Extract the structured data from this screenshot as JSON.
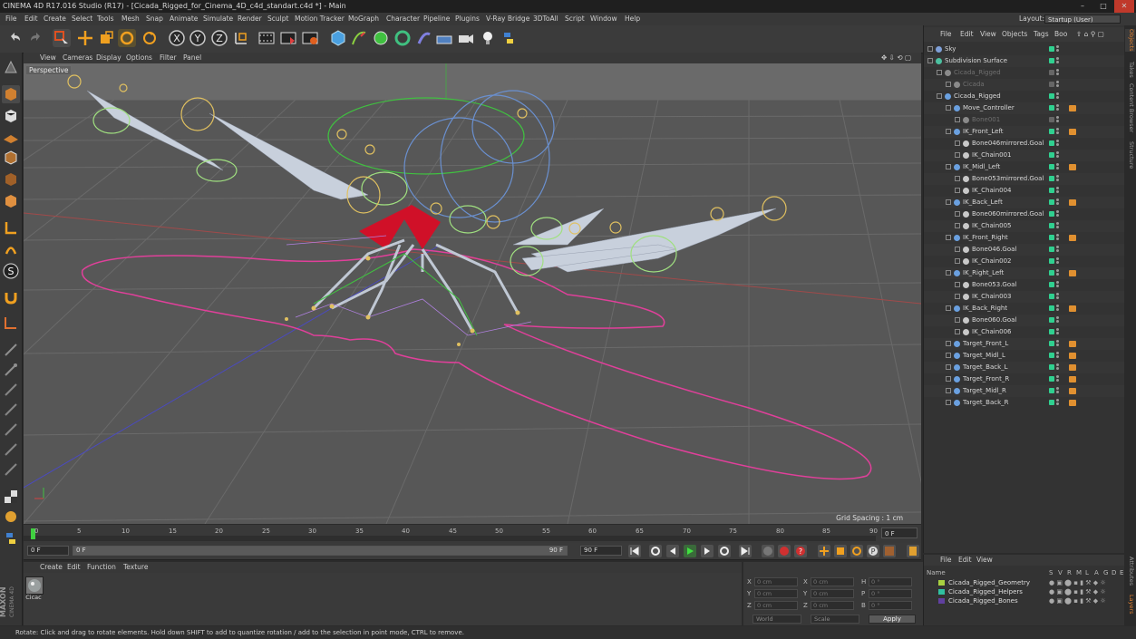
{
  "window": {
    "title": "CINEMA 4D R17.016 Studio (R17) - [Cicada_Rigged_for_Cinema_4D_c4d_standart.c4d *] - Main",
    "controls": [
      "–",
      "□",
      "✕"
    ]
  },
  "menubar": {
    "items": [
      "File",
      "Edit",
      "Create",
      "Select",
      "Tools",
      "Mesh",
      "Snap",
      "Animate",
      "Simulate",
      "Render",
      "Sculpt",
      "Motion Tracker",
      "MoGraph",
      "Character",
      "Pipeline",
      "Plugins",
      "V-Ray Bridge",
      "3DToAll",
      "Script",
      "Window",
      "Help"
    ],
    "layout_label": "Layout:",
    "layout_value": "Startup (User)"
  },
  "toolbar": {
    "axis_x": "X",
    "axis_y": "Y",
    "axis_z": "Z"
  },
  "viewport": {
    "menu": [
      "View",
      "Cameras",
      "Display",
      "Options",
      "Filter",
      "Panel"
    ],
    "label": "Perspective",
    "grid_spacing": "Grid Spacing : 1 cm"
  },
  "timeline": {
    "ticks": [
      "0",
      "5",
      "10",
      "15",
      "20",
      "25",
      "30",
      "35",
      "40",
      "45",
      "50",
      "55",
      "60",
      "65",
      "70",
      "75",
      "80",
      "85",
      "90"
    ],
    "current_frame": "0 F"
  },
  "transport": {
    "start_frame": "0 F",
    "range_start": "0 F",
    "range_end": "90 F",
    "end_frame": "90 F"
  },
  "material_panel": {
    "menu": [
      "Create",
      "Edit",
      "Function",
      "Texture"
    ],
    "material_name": "Cicac"
  },
  "coords": {
    "labels": [
      "X",
      "Y",
      "Z",
      "X",
      "Y",
      "Z",
      "H",
      "P",
      "B"
    ],
    "values": [
      "0 cm",
      "0 cm",
      "0 cm",
      "0 cm",
      "0 cm",
      "0 cm",
      "0 °",
      "0 °",
      "0 °"
    ],
    "mode": "World",
    "scale": "Scale",
    "apply": "Apply"
  },
  "object_manager": {
    "menu": [
      "File",
      "Edit",
      "View",
      "Objects",
      "Tags",
      "Boo"
    ],
    "rows": [
      {
        "name": "Sky",
        "indent": 0,
        "color": "#7fa0d8",
        "dim": false
      },
      {
        "name": "Subdivision Surface",
        "indent": 0,
        "color": "#4cc0a0",
        "dim": false
      },
      {
        "name": "Cicada_Rigged",
        "indent": 1,
        "color": "#8a8a8a",
        "dim": true
      },
      {
        "name": "Cicada",
        "indent": 2,
        "color": "#8a8a8a",
        "dim": true
      },
      {
        "name": "Cicada_Rigged",
        "indent": 1,
        "color": "#6aa0e0",
        "dim": false
      },
      {
        "name": "Move_Controller",
        "indent": 2,
        "color": "#6aa0e0",
        "dim": false
      },
      {
        "name": "Bone001",
        "indent": 3,
        "color": "#8a8a8a",
        "dim": true
      },
      {
        "name": "IK_Front_Left",
        "indent": 2,
        "color": "#6aa0e0",
        "dim": false
      },
      {
        "name": "Bone046mirrored.Goal",
        "indent": 3,
        "color": "#c8c8c8",
        "dim": false
      },
      {
        "name": "IK_Chain001",
        "indent": 3,
        "color": "#c8c8c8",
        "dim": false
      },
      {
        "name": "IK_Midl_Left",
        "indent": 2,
        "color": "#6aa0e0",
        "dim": false
      },
      {
        "name": "Bone053mirrored.Goal",
        "indent": 3,
        "color": "#c8c8c8",
        "dim": false
      },
      {
        "name": "IK_Chain004",
        "indent": 3,
        "color": "#c8c8c8",
        "dim": false
      },
      {
        "name": "IK_Back_Left",
        "indent": 2,
        "color": "#6aa0e0",
        "dim": false
      },
      {
        "name": "Bone060mirrored.Goal",
        "indent": 3,
        "color": "#c8c8c8",
        "dim": false
      },
      {
        "name": "IK_Chain005",
        "indent": 3,
        "color": "#c8c8c8",
        "dim": false
      },
      {
        "name": "IK_Front_Right",
        "indent": 2,
        "color": "#6aa0e0",
        "dim": false
      },
      {
        "name": "Bone046.Goal",
        "indent": 3,
        "color": "#c8c8c8",
        "dim": false
      },
      {
        "name": "IK_Chain002",
        "indent": 3,
        "color": "#c8c8c8",
        "dim": false
      },
      {
        "name": "IK_Right_Left",
        "indent": 2,
        "color": "#6aa0e0",
        "dim": false
      },
      {
        "name": "Bone053.Goal",
        "indent": 3,
        "color": "#c8c8c8",
        "dim": false
      },
      {
        "name": "IK_Chain003",
        "indent": 3,
        "color": "#c8c8c8",
        "dim": false
      },
      {
        "name": "IK_Back_Right",
        "indent": 2,
        "color": "#6aa0e0",
        "dim": false
      },
      {
        "name": "Bone060.Goal",
        "indent": 3,
        "color": "#c8c8c8",
        "dim": false
      },
      {
        "name": "IK_Chain006",
        "indent": 3,
        "color": "#c8c8c8",
        "dim": false
      },
      {
        "name": "Target_Front_L",
        "indent": 2,
        "color": "#6aa0e0",
        "dim": false
      },
      {
        "name": "Target_Midl_L",
        "indent": 2,
        "color": "#6aa0e0",
        "dim": false
      },
      {
        "name": "Target_Back_L",
        "indent": 2,
        "color": "#6aa0e0",
        "dim": false
      },
      {
        "name": "Target_Front_R",
        "indent": 2,
        "color": "#6aa0e0",
        "dim": false
      },
      {
        "name": "Target_Midl_R",
        "indent": 2,
        "color": "#6aa0e0",
        "dim": false
      },
      {
        "name": "Target_Back_R",
        "indent": 2,
        "color": "#6aa0e0",
        "dim": false
      }
    ]
  },
  "layer_manager": {
    "menu": [
      "File",
      "Edit",
      "View"
    ],
    "header_name": "Name",
    "header_cols": [
      "S",
      "V",
      "R",
      "M",
      "L",
      "A",
      "G",
      "D",
      "E"
    ],
    "layers": [
      {
        "name": "Cicada_Rigged_Geometry",
        "color": "#a8d040"
      },
      {
        "name": "Cicada_Rigged_Helpers",
        "color": "#30c0a0"
      },
      {
        "name": "Cicada_Rigged_Bones",
        "color": "#6040a0"
      }
    ]
  },
  "right_tabs": [
    "Objects",
    "Takes",
    "Content Browser",
    "Structure",
    "Attributes",
    "Layers"
  ],
  "status": {
    "text": "Rotate: Click and drag to rotate elements. Hold down SHIFT to add to quantize rotation / add to the selection in point mode, CTRL to remove."
  }
}
